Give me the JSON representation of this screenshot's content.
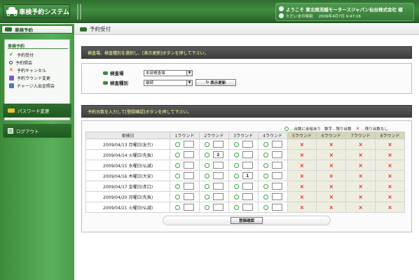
{
  "header": {
    "app_title": "車検予約システム",
    "welcome": "ようこそ 東北根洗越モータースジャパン仙台株式会社 様",
    "current_time_label": "ただいまの時刻",
    "current_time_value": "2009年4月7日 9:47:16"
  },
  "sidebar": {
    "tab_label": "車検予約",
    "section_title": "車検予約",
    "items": [
      {
        "label": "予約受付",
        "icon": "check-icon"
      },
      {
        "label": "予約照会",
        "icon": "magnifier-icon"
      },
      {
        "label": "予約キャンセル",
        "icon": "x-icon"
      },
      {
        "label": "予約ラウンド変更",
        "icon": "calendar-icon"
      },
      {
        "label": "チャージ入出金照会",
        "icon": "document-icon"
      }
    ],
    "password_change": "パスワード変更",
    "logout": "ログアウト"
  },
  "main": {
    "page_title": "予約受付",
    "instruction1": "検査場、検査種別を選択し、[表示更新]ボタンを押して下さい。",
    "inspection_site_label": "検査場",
    "inspection_site_value": "本部検査場",
    "inspection_type_label": "検査種別",
    "inspection_type_value": "継続",
    "refresh_button": "表示更新",
    "instruction2": "予約台数を入力して[登録確認]ボタンを押して下さい。",
    "legend": {
      "available": "…台数に余裕あり",
      "remaining": "数字…残り台数",
      "none": "…残り台数なし"
    },
    "table": {
      "headers": [
        "車検日",
        "1ラウンド",
        "2ラウンド",
        "3ラウンド",
        "4ラウンド",
        "5ラウンド",
        "6ラウンド",
        "7ラウンド",
        "8ラウンド"
      ],
      "rows": [
        {
          "date": "2009/04/13 月曜日(友引)",
          "r2": "",
          "r3": ""
        },
        {
          "date": "2009/04/14 火曜日(先負)",
          "r2": "2",
          "r3": ""
        },
        {
          "date": "2009/04/15 水曜日(仏滅)",
          "r2": "",
          "r3": ""
        },
        {
          "date": "2009/04/16 木曜日(大安)",
          "r2": "",
          "r3": "1"
        },
        {
          "date": "2009/04/17 金曜日(赤口)",
          "r2": "",
          "r3": ""
        },
        {
          "date": "2009/04/20 月曜日(先負)",
          "r2": "",
          "r3": ""
        },
        {
          "date": "2009/04/21 火曜日(仏滅)",
          "r2": "",
          "r3": ""
        }
      ],
      "closed_mark": "×"
    },
    "submit_button": "登録確認"
  }
}
